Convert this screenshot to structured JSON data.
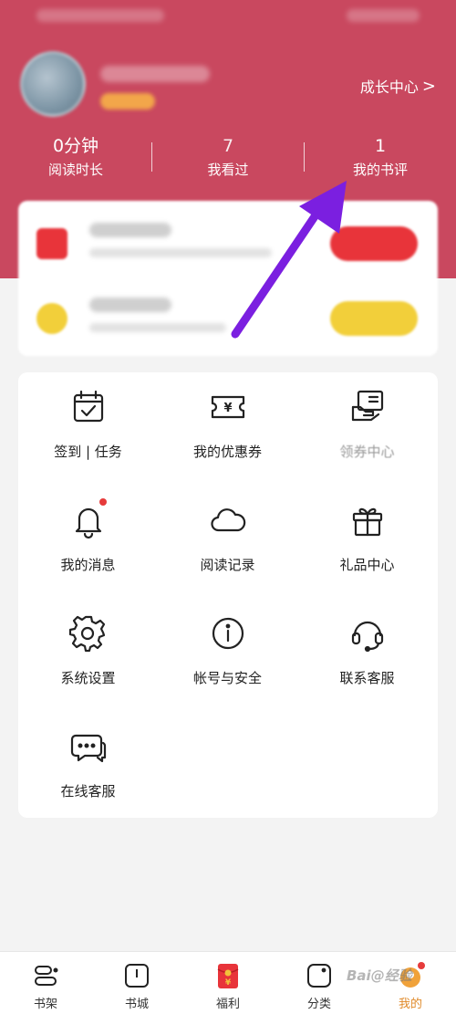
{
  "header": {
    "growth_center": "成长中心",
    "chevron": ">",
    "stats": [
      {
        "value": "0分钟",
        "label": "阅读时长"
      },
      {
        "value": "7",
        "label": "我看过"
      },
      {
        "value": "1",
        "label": "我的书评"
      }
    ]
  },
  "colors": {
    "header_bg": "#c9485f",
    "promo_red": "#e8343a",
    "promo_yellow": "#f2cf3a",
    "annotation_arrow": "#7b1fe0",
    "active_tab": "#e08a2a"
  },
  "menu": {
    "items": [
      {
        "label": "签到 | 任务",
        "icon": "calendar-check-icon"
      },
      {
        "label": "我的优惠券",
        "icon": "coupon-yen-icon"
      },
      {
        "label": "领券中心",
        "icon": "coupon-center-icon"
      },
      {
        "label": "我的消息",
        "icon": "bell-icon"
      },
      {
        "label": "阅读记录",
        "icon": "cloud-icon"
      },
      {
        "label": "礼品中心",
        "icon": "gift-icon"
      },
      {
        "label": "系统设置",
        "icon": "gear-icon"
      },
      {
        "label": "帐号与安全",
        "icon": "info-icon"
      },
      {
        "label": "联系客服",
        "icon": "headset-icon"
      },
      {
        "label": "在线客服",
        "icon": "chat-bubble-icon"
      }
    ]
  },
  "tabbar": {
    "tabs": [
      {
        "label": "书架",
        "icon": "bookshelf-icon"
      },
      {
        "label": "书城",
        "icon": "book-icon"
      },
      {
        "label": "福利",
        "icon": "red-envelope-icon"
      },
      {
        "label": "分类",
        "icon": "category-icon"
      },
      {
        "label": "我的",
        "icon": "profile-icon"
      }
    ],
    "active": "我的"
  },
  "watermark": "Bai@经验"
}
